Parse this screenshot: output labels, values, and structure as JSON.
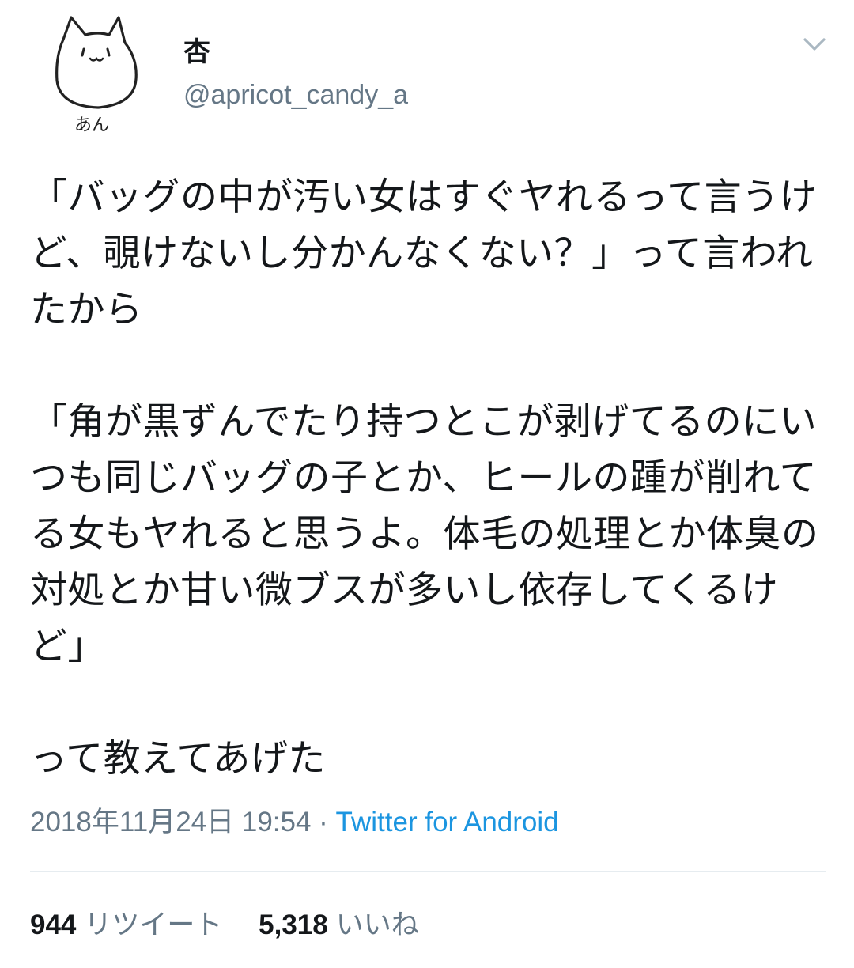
{
  "user": {
    "display_name": "杏",
    "handle": "@apricot_candy_a",
    "avatar_caption": "あん"
  },
  "tweet": {
    "text": "「バッグの中が汚い女はすぐヤれるって言うけど、覗けないし分かんなくない？」って言われたから\n\n「角が黒ずんでたり持つとこが剥げてるのにいつも同じバッグの子とか、ヒールの踵が削れてる女もヤれると思うよ。体毛の処理とか体臭の対処とか甘い微ブスが多いし依存してくるけど」\n\nって教えてあげた",
    "timestamp": "2018年11月24日 19:54",
    "separator": " · ",
    "source": "Twitter for Android"
  },
  "stats": {
    "retweets_count": "944",
    "retweets_label": "リツイート",
    "likes_count": "5,318",
    "likes_label": "いいね"
  },
  "icons": {
    "menu": "chevron-down-icon",
    "avatar": "cat-face-drawing"
  },
  "colors": {
    "text_primary": "#14171a",
    "text_secondary": "#657786",
    "link": "#1b95e0",
    "divider": "#e6ecf0"
  }
}
